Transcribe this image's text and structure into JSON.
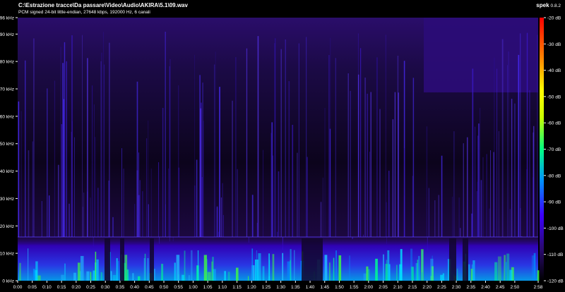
{
  "header": {
    "file_path": "C:\\Estrazione tracce\\Da passare\\Video\\Audio\\AKIRA\\5.1\\09.wav",
    "stream_info": "PCM signed 24-bit little-endian, 27648 kbps, 192000 Hz, 6 canali",
    "app_name": "spek",
    "app_version": "0.8.2"
  },
  "chart_data": {
    "type": "heatmap",
    "title": "",
    "xlabel": "",
    "ylabel": "",
    "x_ticks": [
      "0:00",
      "0:05",
      "0:10",
      "0:15",
      "0:20",
      "0:25",
      "0:30",
      "0:35",
      "0:40",
      "0:45",
      "0:50",
      "0:55",
      "1:00",
      "1:05",
      "1:10",
      "1:15",
      "1:20",
      "1:25",
      "1:30",
      "1:35",
      "1:40",
      "1:45",
      "1:50",
      "1:55",
      "2:00",
      "2:05",
      "2:10",
      "2:15",
      "2:20",
      "2:25",
      "2:30",
      "2:35",
      "2:40",
      "2:45",
      "2:50",
      "2:58"
    ],
    "y_ticks": [
      "0 kHz",
      "10 kHz",
      "20 kHz",
      "30 kHz",
      "40 kHz",
      "50 kHz",
      "60 kHz",
      "70 kHz",
      "80 kHz",
      "90 kHz",
      "96 kHz"
    ],
    "y_range_khz": [
      0,
      96
    ],
    "x_range_seconds": [
      0,
      178
    ],
    "colorbar": {
      "labels": [
        "-20 dB",
        "-30 dB",
        "-40 dB",
        "-50 dB",
        "-60 dB",
        "-70 dB",
        "-80 dB",
        "-90 dB",
        "-100 dB",
        "-110 dB",
        "-120 dB"
      ],
      "range_db": [
        -120,
        -20
      ],
      "colors": [
        "#000000",
        "#2a0a6e",
        "#3c00ff",
        "#0090ff",
        "#00ff80",
        "#c8ff00",
        "#ffff00",
        "#ff8000",
        "#ff0000"
      ]
    },
    "approx_energy_band_khz": [
      0,
      16
    ],
    "background_color": "#1a0740",
    "high_freq_region_color": "#3b13a0"
  }
}
